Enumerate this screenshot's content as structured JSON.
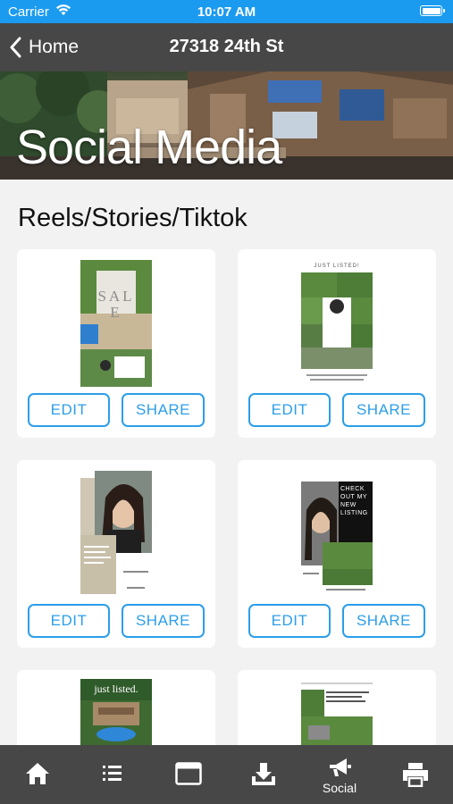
{
  "status_bar": {
    "carrier": "Carrier",
    "time": "10:07 AM"
  },
  "nav": {
    "back_label": "Home",
    "title": "27318 24th St"
  },
  "hero": {
    "title": "Social Media"
  },
  "section": {
    "title": "Reels/Stories/Tiktok"
  },
  "cards": [
    {
      "edit_label": "EDIT",
      "share_label": "SHARE",
      "thumb_text": "SALE"
    },
    {
      "edit_label": "EDIT",
      "share_label": "SHARE",
      "thumb_text": "JUST LISTED!"
    },
    {
      "edit_label": "EDIT",
      "share_label": "SHARE",
      "thumb_text": ""
    },
    {
      "edit_label": "EDIT",
      "share_label": "SHARE",
      "thumb_text": "CHECK OUT MY NEW LISTING"
    },
    {
      "thumb_text": "just listed."
    },
    {
      "thumb_text": ""
    }
  ],
  "tab_bar": {
    "tabs": [
      {
        "icon": "home-icon"
      },
      {
        "icon": "list-icon"
      },
      {
        "icon": "browser-icon"
      },
      {
        "icon": "download-icon"
      },
      {
        "icon": "megaphone-icon",
        "label": "Social",
        "active": true
      },
      {
        "icon": "printer-icon"
      }
    ]
  },
  "colors": {
    "status_bar": "#1b9bef",
    "nav_bar": "#474747",
    "accent": "#2c9ee8",
    "background": "#f2f2f2"
  }
}
